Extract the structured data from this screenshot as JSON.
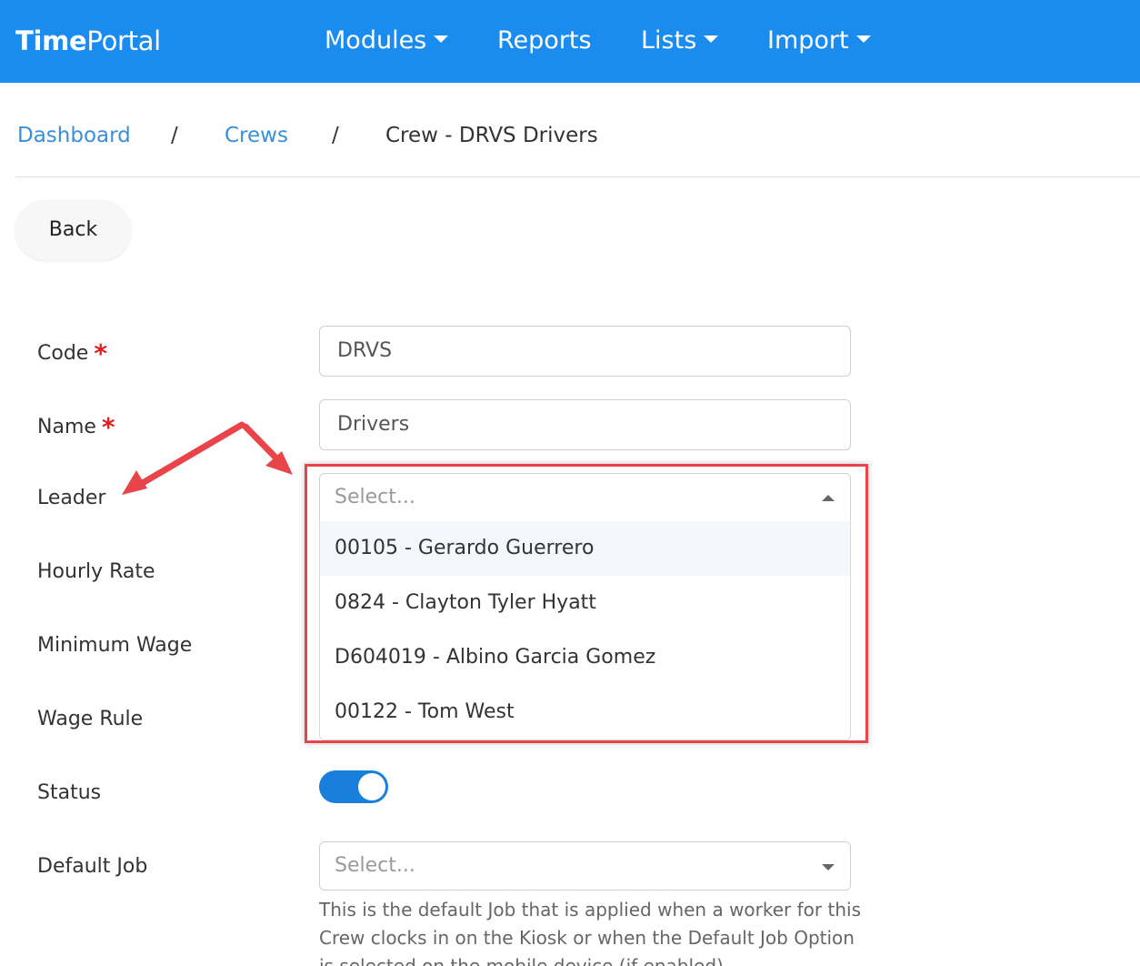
{
  "navbar": {
    "brand_bold": "Time",
    "brand_regular": "Portal",
    "items": [
      {
        "label": "Modules",
        "has_dropdown": true
      },
      {
        "label": "Reports",
        "has_dropdown": false
      },
      {
        "label": "Lists",
        "has_dropdown": true
      },
      {
        "label": "Import",
        "has_dropdown": true
      }
    ],
    "background_color": "#1a8cf0"
  },
  "breadcrumb": {
    "items": [
      "Dashboard",
      "Crews"
    ],
    "separator": "/",
    "current": "Crew - DRVS Drivers"
  },
  "back_button": {
    "label": "Back"
  },
  "form": {
    "code": {
      "label": "Code",
      "required_mark": "*",
      "value": "DRVS"
    },
    "name": {
      "label": "Name",
      "required_mark": "*",
      "value": "Drivers"
    },
    "leader": {
      "label": "Leader",
      "placeholder": "Select...",
      "options": [
        "00105 - Gerardo Guerrero",
        "0824 - Clayton Tyler Hyatt",
        "D604019 - Albino Garcia Gomez",
        "00122 - Tom West"
      ]
    },
    "hourly_rate": {
      "label": "Hourly Rate"
    },
    "minimum_wage": {
      "label": "Minimum Wage"
    },
    "wage_rule": {
      "label": "Wage Rule"
    },
    "status": {
      "label": "Status",
      "enabled": true
    },
    "default_job": {
      "label": "Default Job",
      "placeholder": "Select...",
      "help_text": "This is the default Job that is applied when a worker for this Crew clocks in on the Kiosk or when the Default Job Option is selected on the mobile device (if enabled)."
    }
  },
  "annotation": {
    "color": "#e8444a"
  }
}
